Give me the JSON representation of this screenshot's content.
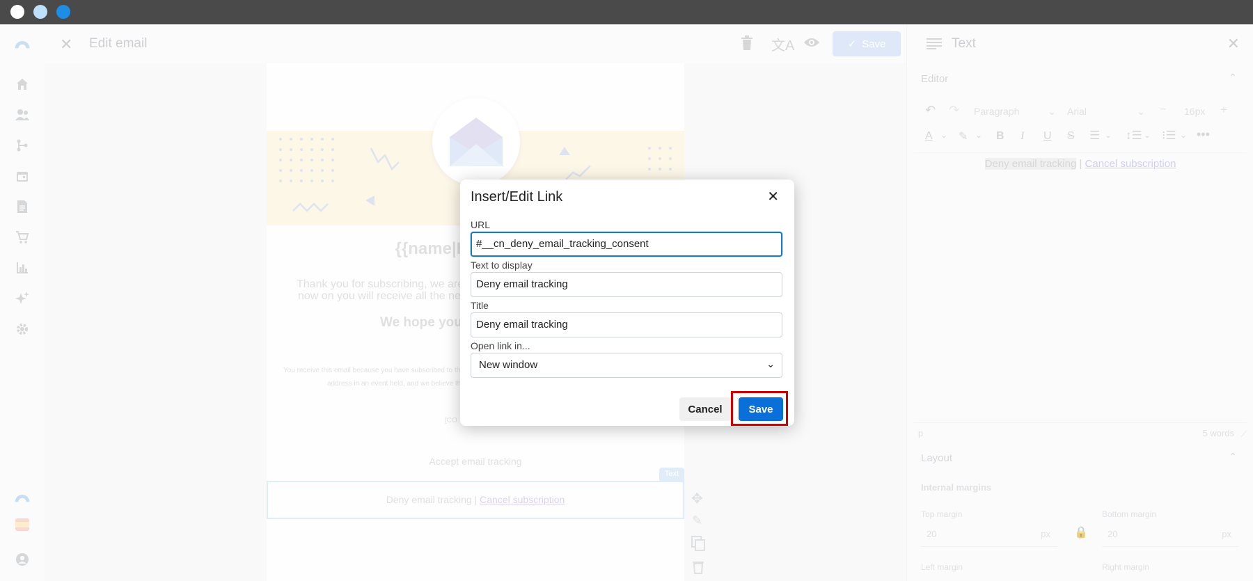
{
  "window": {
    "traffic_lights": [
      "#ffffff",
      "#bfe0fb",
      "#1e8de5"
    ]
  },
  "topbar": {
    "title": "Edit email",
    "save_label": "Save"
  },
  "rail": {
    "icons": [
      "home-icon",
      "users-icon",
      "flow-icon",
      "calendar-icon",
      "document-icon",
      "cart-icon",
      "chart-icon",
      "sparkle-icon",
      "gear-icon"
    ]
  },
  "email": {
    "heading": "{{name|Hello}}, welc",
    "body_line1": "Thank you for subscribing, we are",
    "body_line2": "now on you will receive all the ne",
    "hope": "We hope you",
    "footer_line1": "You receive this email because you have subscribed to th",
    "footer_line2": "address in an event held, and we believe th",
    "company": "[CO",
    "accept": "Accept email tracking",
    "deny": "Deny email tracking",
    "separator": " | ",
    "cancel_sub": "Cancel subscription",
    "text_badge": "Text"
  },
  "panel": {
    "title": "Text",
    "editor_section": "Editor",
    "block_format": "Paragraph",
    "font": "Arial",
    "font_size": "16px",
    "content_deny": "Deny email tracking",
    "content_sep": " | ",
    "content_cancel": "Cancel subscription",
    "status_path": "p",
    "word_count": "5 words",
    "layout_section": "Layout",
    "internal_margins": "Internal margins",
    "top_margin_label": "Top margin",
    "top_margin_value": "20",
    "bottom_margin_label": "Bottom margin",
    "bottom_margin_value": "20",
    "unit": "px",
    "left_margin_label": "Left margin",
    "right_margin_label": "Right margin"
  },
  "dialog": {
    "title": "Insert/Edit Link",
    "url_label": "URL",
    "url_value": "#__cn_deny_email_tracking_consent",
    "text_label": "Text to display",
    "text_value": "Deny email tracking",
    "title_label": "Title",
    "title_value": "Deny email tracking",
    "open_label": "Open link in...",
    "open_value": "New window",
    "cancel_label": "Cancel",
    "save_label": "Save"
  }
}
